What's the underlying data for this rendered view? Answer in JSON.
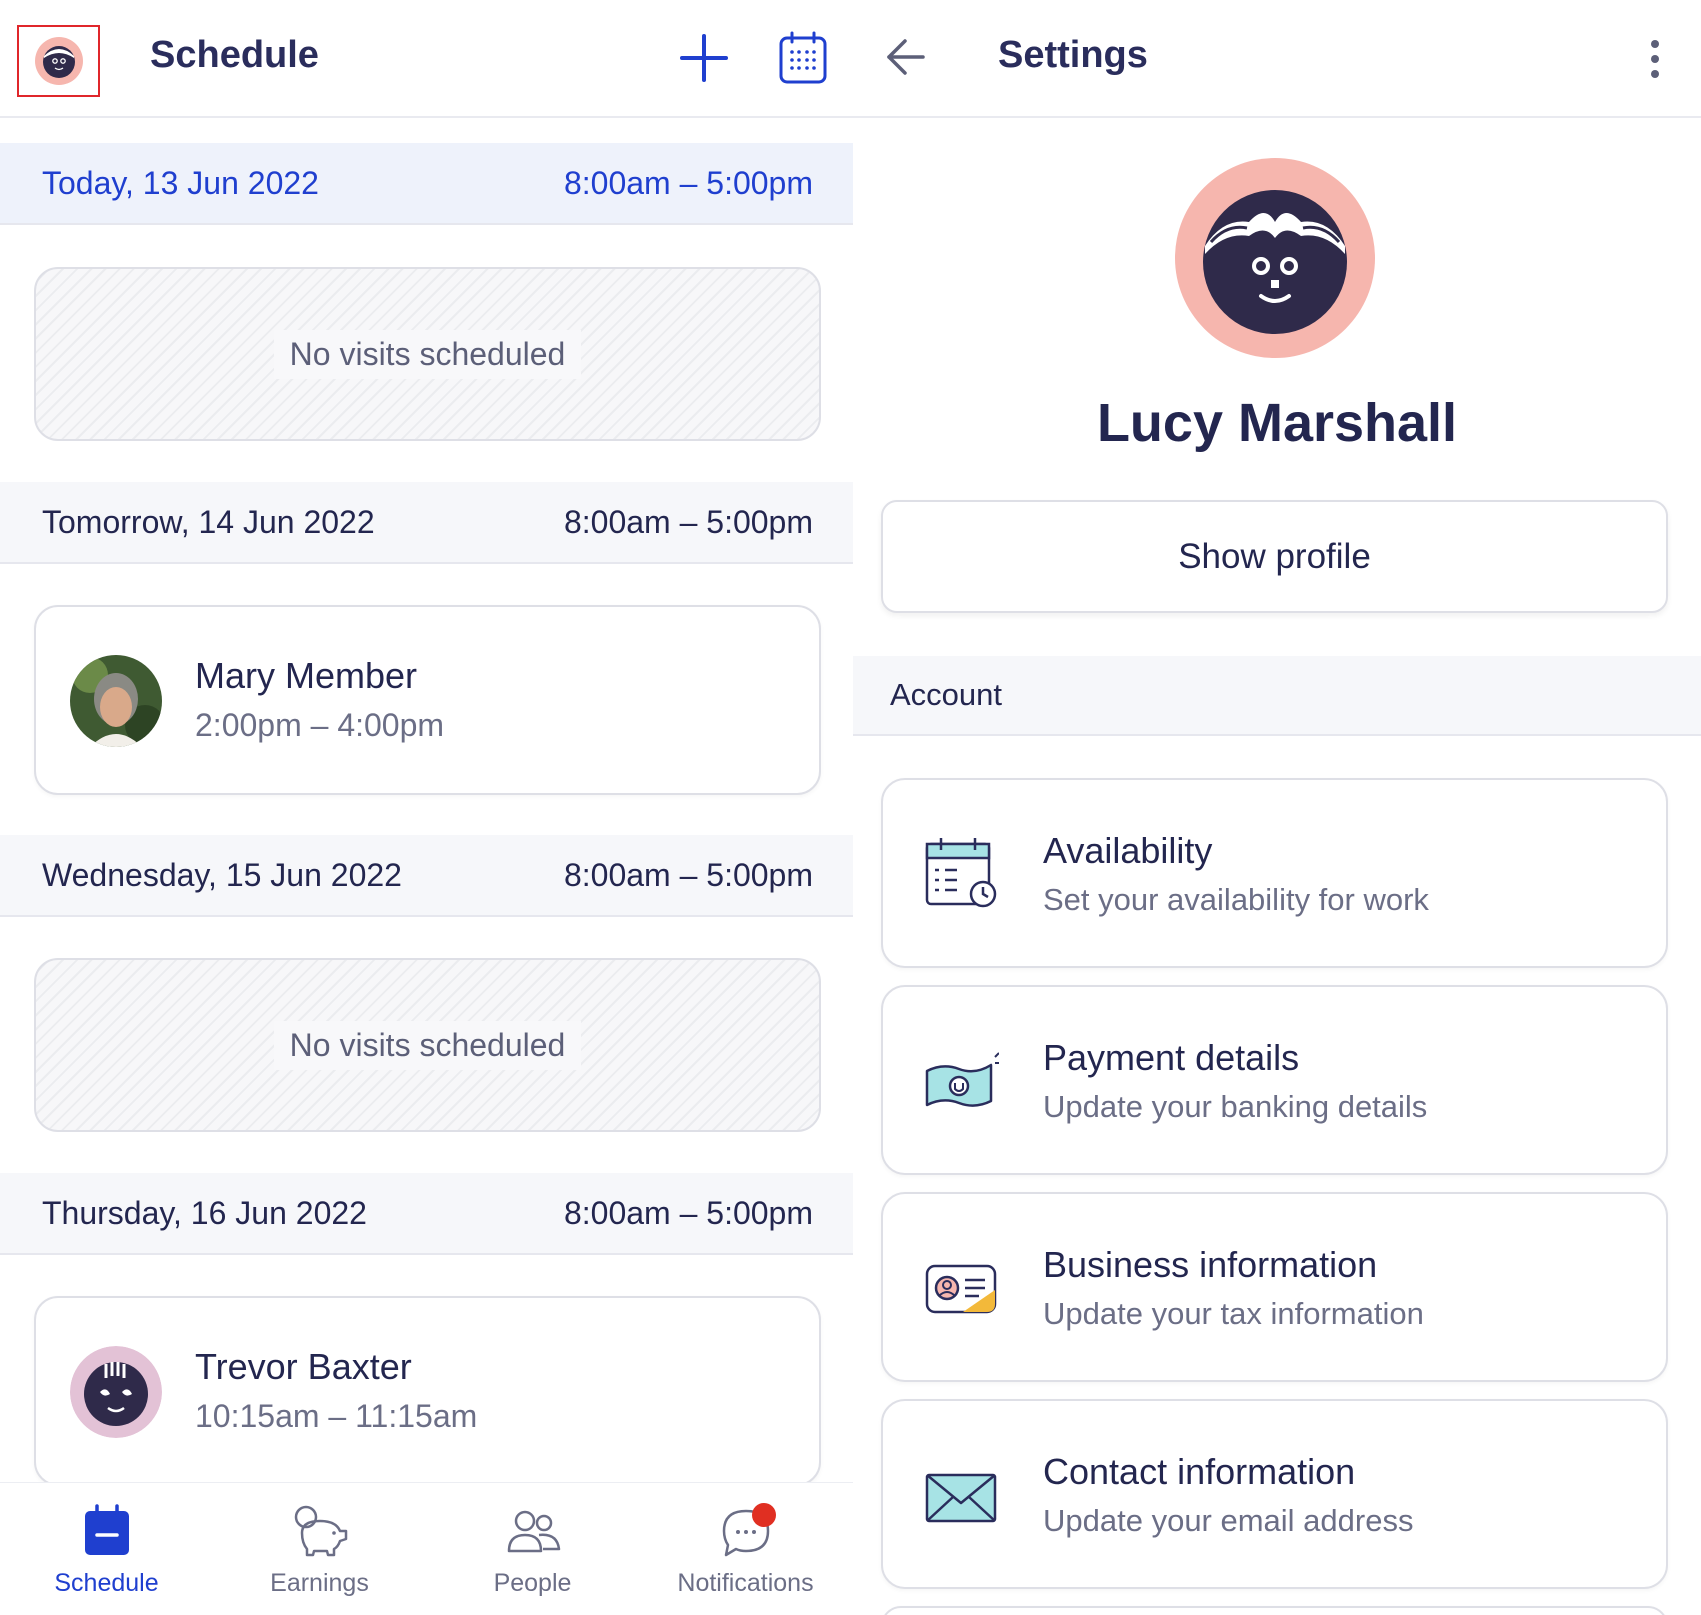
{
  "schedule": {
    "title": "Schedule",
    "days": [
      {
        "label": "Today, 13 Jun 2022",
        "hours": "8:00am – 5:00pm",
        "empty_text": "No visits scheduled"
      },
      {
        "label": "Tomorrow, 14 Jun 2022",
        "hours": "8:00am – 5:00pm",
        "visit": {
          "name": "Mary Member",
          "time": "2:00pm – 4:00pm"
        }
      },
      {
        "label": "Wednesday, 15 Jun 2022",
        "hours": "8:00am – 5:00pm",
        "empty_text": "No visits scheduled"
      },
      {
        "label": "Thursday, 16 Jun 2022",
        "hours": "8:00am – 5:00pm",
        "visit": {
          "name": "Trevor Baxter",
          "time": "10:15am – 11:15am"
        }
      }
    ]
  },
  "nav": {
    "items": [
      {
        "label": "Schedule",
        "icon": "calendar-icon",
        "active": true
      },
      {
        "label": "Earnings",
        "icon": "piggy-bank-icon"
      },
      {
        "label": "People",
        "icon": "people-icon"
      },
      {
        "label": "Notifications",
        "icon": "chat-bubble-icon"
      }
    ]
  },
  "settings": {
    "title": "Settings",
    "profile_name": "Lucy Marshall",
    "show_profile_label": "Show profile",
    "section_label": "Account",
    "items": [
      {
        "title": "Availability",
        "subtitle": "Set your availability for work",
        "icon": "calendar-clock-icon"
      },
      {
        "title": "Payment details",
        "subtitle": "Update your banking details",
        "icon": "banknote-icon"
      },
      {
        "title": "Business information",
        "subtitle": "Update your tax information",
        "icon": "id-card-icon"
      },
      {
        "title": "Contact information",
        "subtitle": "Update your email address",
        "icon": "envelope-icon"
      }
    ]
  },
  "colors": {
    "accent_blue": "#1f3fcf",
    "text_dark": "#23264f",
    "text_muted": "#6b6e86",
    "highlight_box": "#e0262b",
    "notification_dot": "#e02f22",
    "avatar_ring": "#f6b6ae"
  }
}
